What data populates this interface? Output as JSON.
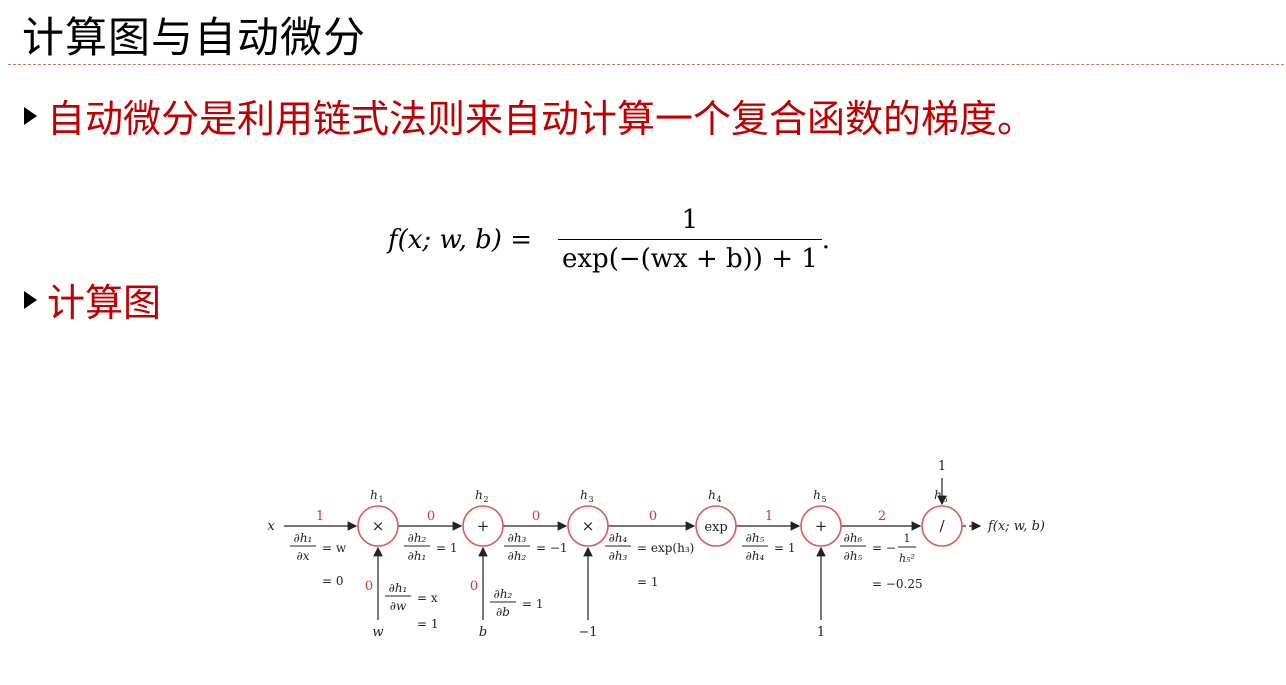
{
  "title": "计算图与自动微分",
  "bullets": [
    "自动微分是利用链式法则来自动计算一个复合函数的梯度。",
    "计算图"
  ],
  "formula": {
    "lhs": "f(x; w, b) =",
    "numerator": "1",
    "denominator": "exp(−(wx + b)) + 1",
    "end": "."
  },
  "graph": {
    "colors": {
      "node": "#e05a4f",
      "grad": "#d9303a",
      "text": "#222222"
    },
    "inputs": {
      "x": "x",
      "w": "w",
      "b": "b",
      "neg1": "−1",
      "one5": "1",
      "top1": "1"
    },
    "output": "f(x; w, b)",
    "nodes": [
      {
        "id": "h1",
        "label": "h",
        "sub": "1",
        "op": "×"
      },
      {
        "id": "h2",
        "label": "h",
        "sub": "2",
        "op": "+"
      },
      {
        "id": "h3",
        "label": "h",
        "sub": "3",
        "op": "×"
      },
      {
        "id": "h4",
        "label": "h",
        "sub": "4",
        "op": "exp"
      },
      {
        "id": "h5",
        "label": "h",
        "sub": "5",
        "op": "+"
      },
      {
        "id": "h6",
        "label": "h",
        "sub": "6",
        "op": "/"
      }
    ],
    "edge_grads": [
      "1",
      "0",
      "0",
      "0",
      "1",
      "2"
    ],
    "input_grads": {
      "w": "0",
      "b": "0"
    },
    "derivs": {
      "d1": {
        "num": "∂h₁",
        "den": "∂x",
        "eq": "= w",
        "val": "= 0"
      },
      "d2": {
        "num": "∂h₂",
        "den": "∂h₁",
        "eq": "= 1"
      },
      "d3": {
        "num": "∂h₃",
        "den": "∂h₂",
        "eq": "= −1"
      },
      "d4": {
        "num": "∂h₄",
        "den": "∂h₃",
        "eq": "= exp(h₃)",
        "val": "= 1"
      },
      "d5": {
        "num": "∂h₅",
        "den": "∂h₄",
        "eq": "= 1"
      },
      "d6": {
        "num": "∂h₆",
        "den": "∂h₅",
        "eq": "= −",
        "fnum": "1",
        "fden": "h₅²",
        "val": "= −0.25"
      },
      "dw": {
        "num": "∂h₁",
        "den": "∂w",
        "eq": "= x",
        "val": "= 1"
      },
      "db": {
        "num": "∂h₂",
        "den": "∂b",
        "eq": "= 1"
      }
    }
  }
}
